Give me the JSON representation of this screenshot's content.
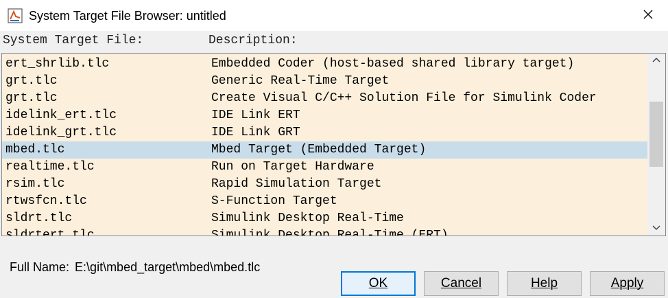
{
  "window": {
    "title": "System Target File Browser: untitled",
    "app_icon": "simulink-icon",
    "close_icon": "close-icon"
  },
  "columns": {
    "file": "System Target File:",
    "description": "Description:"
  },
  "rows": [
    {
      "file": "ert_shrlib.tlc",
      "description": "Embedded Coder (host-based shared library target)"
    },
    {
      "file": "grt.tlc",
      "description": "Generic Real-Time Target"
    },
    {
      "file": "grt.tlc",
      "description": "Create Visual C/C++ Solution File for Simulink Coder"
    },
    {
      "file": "idelink_ert.tlc",
      "description": "IDE Link ERT"
    },
    {
      "file": "idelink_grt.tlc",
      "description": "IDE Link GRT"
    },
    {
      "file": "mbed.tlc",
      "description": "Mbed Target (Embedded Target)",
      "selected": true
    },
    {
      "file": "realtime.tlc",
      "description": "Run on Target Hardware"
    },
    {
      "file": "rsim.tlc",
      "description": "Rapid Simulation Target"
    },
    {
      "file": "rtwsfcn.tlc",
      "description": "S-Function Target"
    },
    {
      "file": "sldrt.tlc",
      "description": "Simulink Desktop Real-Time"
    },
    {
      "file": "sldrtert.tlc",
      "description": "Simulink Desktop Real-Time (ERT)"
    }
  ],
  "full_name": {
    "label": "Full Name:",
    "value": "E:\\git\\mbed_target\\mbed\\mbed.tlc"
  },
  "buttons": {
    "ok": "OK",
    "cancel": "Cancel",
    "help": "Help",
    "apply": "Apply"
  },
  "colors": {
    "list_background": "#fcf0dc",
    "selected_row": "#c8dde9",
    "default_button_border": "#0078d7"
  }
}
